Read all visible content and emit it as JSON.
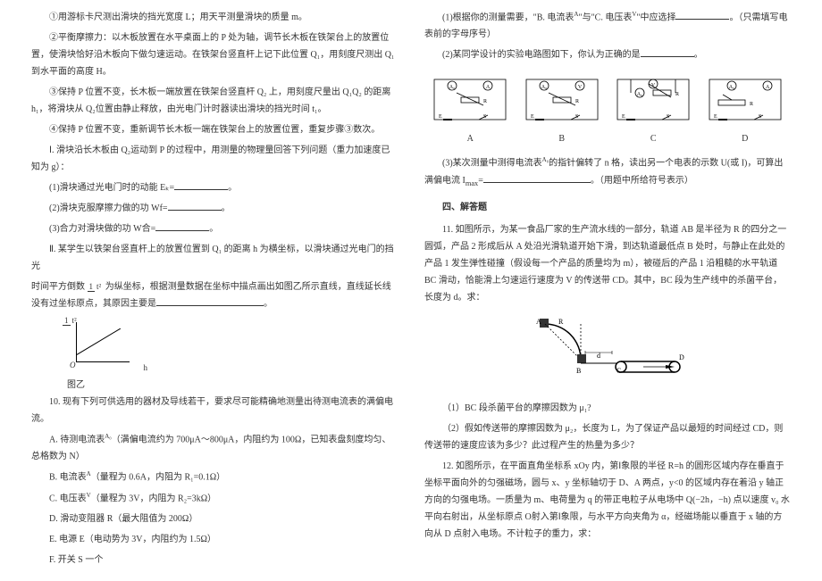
{
  "left": {
    "p1": "①用游标卡尺测出滑块的挡光宽度 L；用天平测量滑块的质量 m。",
    "p2": "②平衡摩擦力：以木板放置在水平桌面上的 P 处为轴，调节长木板在铁架台上的放置位置，使滑块恰好沿木板向下做匀速运动。在铁架台竖直杆上记下此位置 Q₁，用刻度尺测出 Q₁ 到水平面的高度 H。",
    "p3": "③保持 P 位置不变，长木板一端放置在铁架台竖直杆 Q₂ 上，用刻度尺量出 Q₁Q₂ 的距离 h₁，将滑块从 Q₂位置由静止释放，由光电门计时器读出滑块的挡光时间 t₁。",
    "p4": "④保持 P 位置不变，重新调节长木板一端在铁架台上的放置位置，重复步骤③数次。",
    "p5": "Ⅰ. 滑块沿长木板由 Q₂运动到 P 的过程中，用测量的物理量回答下列问题（重力加速度已知为 g）：",
    "p6": "(1)滑块通过光电门时的动能 Eₖ=",
    "p7": "(2)滑块克服摩擦力做的功 Wf=",
    "p8": "(3)合力对滑块做的功 W合=",
    "p9_a": "Ⅱ. 某学生以铁架台竖直杆上的放置位置到 Q₁ 的距离 h 为横坐标，以滑块通过光电门的挡光",
    "p9_b": "时间平方倒数",
    "p9_c": "为纵坐标，根据测量数据在坐标中描点画出如图乙所示直线，直线延长线没有过坐标原点，其原因主要是",
    "graph_y": "1/t²",
    "graph_x": "h",
    "graph_caption": "图乙",
    "p10": "10. 现有下列可供选用的器材及导线若干，要求尽可能精确地测量出待测电流表的满偏电流。",
    "p11_a": "A. 待测电流表",
    "p11_b": "（满偏电流约为 700μA～800μA，内阻约为 100Ω，已知表盘刻度均匀、总格数为 N）",
    "p12_a": "B. 电流表",
    "p12_b": "（量程为 0.6A，内阻为 R₁=0.1Ω）",
    "p13_a": "C. 电压表",
    "p13_b": "（量程为 3V，内阻为 R₂=3kΩ）",
    "p14": "D. 滑动变阻器 R（最大阻值为 200Ω）",
    "p15": "E. 电源 E（电动势为 3V，内阻约为 1.5Ω）",
    "p16": "F. 开关 S 一个"
  },
  "right": {
    "p1_a": "(1)根据你的测量需要，\"B. 电流表",
    "p1_b": "\"与\"C. 电压表",
    "p1_c": "\"中应选择",
    "p1_d": "。（只需填写电表前的字母序号）",
    "p2": "(2)某同学设计的实验电路图如下，你认为正确的是",
    "circuit_a": "A",
    "circuit_b": "B",
    "circuit_c": "C",
    "circuit_d": "D",
    "p3_a": "(3)某次测量中测得电流表",
    "p3_b": "的指针偏转了 n 格，读出另一个电表的示数 U(或 I)，可算出满偏电流 I",
    "p3_c": "=",
    "p3_d": "。（用题中所给符号表示）",
    "section": "四、解答题",
    "q11": "11. 如图所示，为某一食品厂家的生产流水线的一部分，轨道 AB 是半径为 R 的四分之一圆弧，产品 2 形成后从 A 处沿光滑轨道开始下滑，到达轨道最低点 B 处时，与静止在此处的产品 1 发生弹性碰撞（假设每一个产品的质量均为 m），被碰后的产品 1 沿粗糙的水平轨道 BC 滑动，恰能滑上匀速运行速度为 V 的传送带 CD。其中，BC 段为生产线中的杀菌平台，长度为 d。求：",
    "conv_labels": {
      "A": "A",
      "B": "B",
      "C": "C",
      "D": "D",
      "R": "R",
      "d": "d"
    },
    "q11_1": "（1）BC 段杀菌平台的摩擦因数为 μ₁?",
    "q11_2": "（2）假如传送带的摩擦因数为 μ₂，长度为 L，为了保证产品以最短的时间经过 CD，则传送带的速度应该为多少？此过程产生的热量为多少？",
    "q12": "12. 如图所示，在平面直角坐标系 xOy 内，第Ⅰ象限的半径 R=h 的圆形区域内存在垂直于坐标平面向外的匀强磁场，圆与 x、y 坐标轴切于 D、A 两点，y<0 的区域内存在着沿 y 轴正方向的匀强电场。一质量为 m、电荷量为 q 的带正电粒子从电场中 Q(−2h，−h) 点以速度 v₀ 水平向右射出，从坐标原点 O射入第Ⅰ象限，与水平方向夹角为 α，经磁场能以垂直于 x 轴的方向从 D 点射入电场。不计粒子的重力，求："
  }
}
